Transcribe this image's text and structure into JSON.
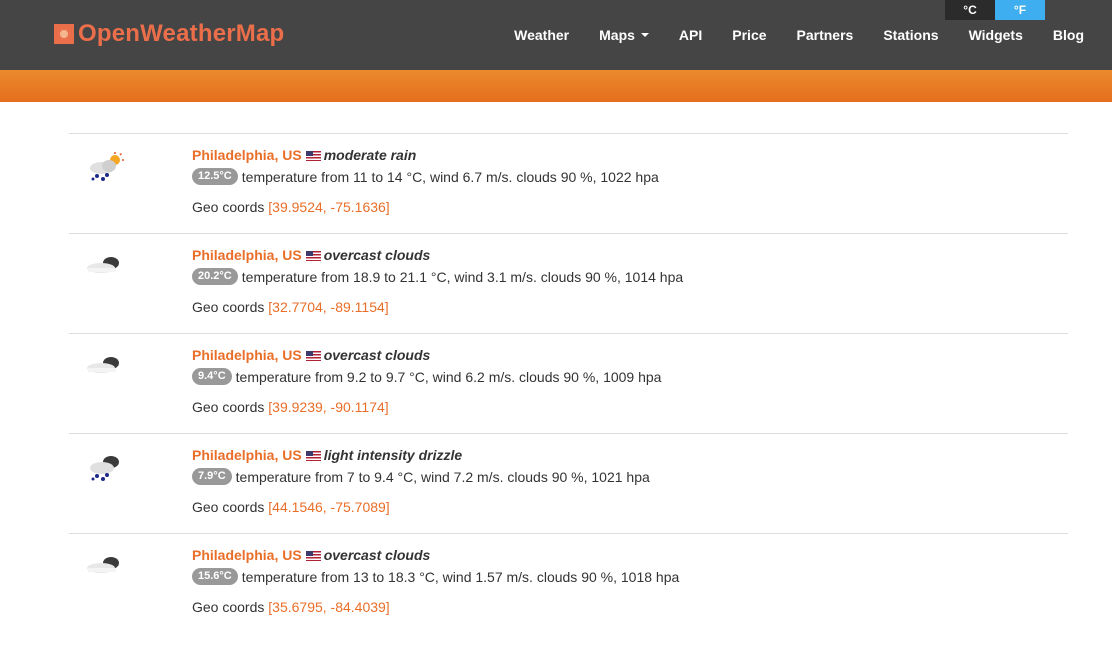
{
  "header": {
    "logo_text": "OpenWeatherMap",
    "nav": [
      {
        "label": "Weather"
      },
      {
        "label": "Maps"
      },
      {
        "label": "API"
      },
      {
        "label": "Price"
      },
      {
        "label": "Partners"
      },
      {
        "label": "Stations"
      },
      {
        "label": "Widgets"
      },
      {
        "label": "Blog"
      }
    ],
    "units": {
      "celsius": "°C",
      "fahrenheit": "°F",
      "selected": "°F"
    }
  },
  "colors": {
    "accent": "#e96e28",
    "topbar": "#454545",
    "orange_bar": "#e8791f",
    "unit_selected": "#3faef0"
  },
  "results": [
    {
      "icon": "rain-sun-icon",
      "city": "Philadelphia, US",
      "condition": "moderate rain",
      "temp": "12.5°C",
      "details": "temperature from 11 to 14 °C, wind 6.7 m/s. clouds 90 %, 1022 hpa",
      "geo_label": "Geo coords",
      "coords": "[39.9524, -75.1636]"
    },
    {
      "icon": "overcast-clouds-icon",
      "city": "Philadelphia, US",
      "condition": "overcast clouds",
      "temp": "20.2°C",
      "details": "temperature from 18.9 to 21.1 °C, wind 3.1 m/s. clouds 90 %, 1014 hpa",
      "geo_label": "Geo coords",
      "coords": "[32.7704, -89.1154]"
    },
    {
      "icon": "overcast-clouds-icon",
      "city": "Philadelphia, US",
      "condition": "overcast clouds",
      "temp": "9.4°C",
      "details": "temperature from 9.2 to 9.7 °C, wind 6.2 m/s. clouds 90 %, 1009 hpa",
      "geo_label": "Geo coords",
      "coords": "[39.9239, -90.1174]"
    },
    {
      "icon": "drizzle-icon",
      "city": "Philadelphia, US",
      "condition": "light intensity drizzle",
      "temp": "7.9°C",
      "details": "temperature from 7 to 9.4 °C, wind 7.2 m/s. clouds 90 %, 1021 hpa",
      "geo_label": "Geo coords",
      "coords": "[44.1546, -75.7089]"
    },
    {
      "icon": "overcast-clouds-icon",
      "city": "Philadelphia, US",
      "condition": "overcast clouds",
      "temp": "15.6°C",
      "details": "temperature from 13 to 18.3 °C, wind 1.57 m/s. clouds 90 %, 1018 hpa",
      "geo_label": "Geo coords",
      "coords": "[35.6795, -84.4039]"
    }
  ]
}
